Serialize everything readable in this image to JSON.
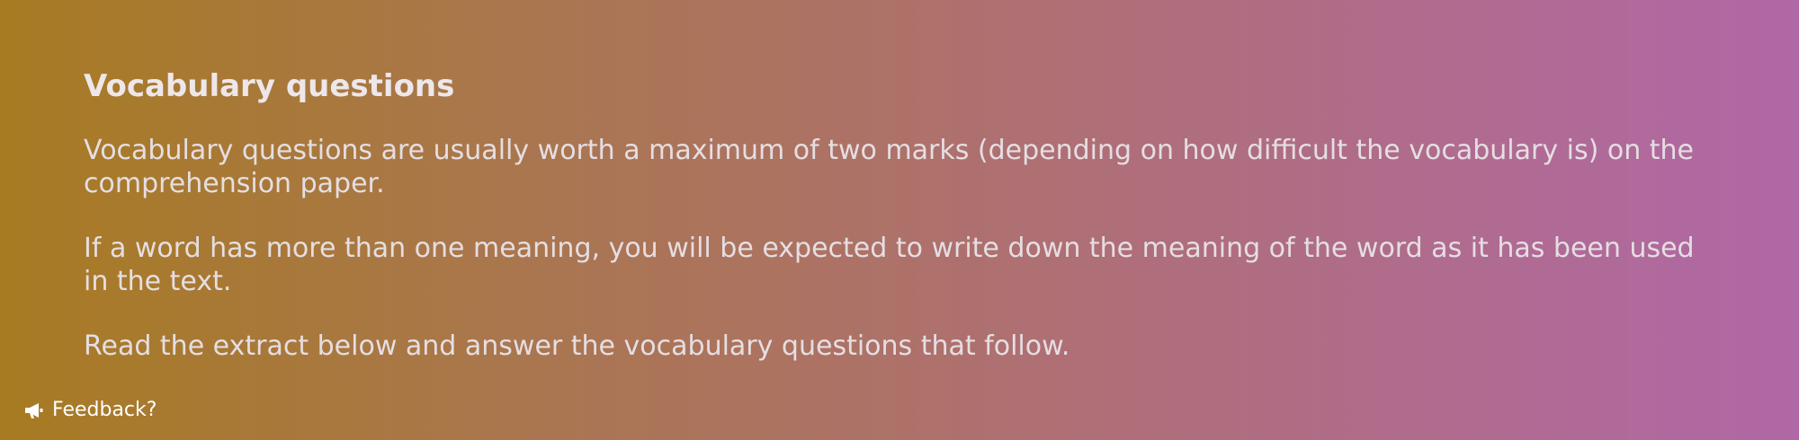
{
  "section": {
    "heading": "Vocabulary questions",
    "paragraphs": [
      "Vocabulary questions are usually worth a maximum of two marks (depending on how difficult the vocabulary is) on the comprehension paper.",
      "If a word has more than one meaning, you will be expected to write down the meaning of the word as it has been used in the text.",
      "Read the extract below and answer the vocabulary questions that follow."
    ]
  },
  "feedback": {
    "label": "Feedback?",
    "icon": "megaphone-icon"
  },
  "colors": {
    "gradient_start": "#A77B22",
    "gradient_end": "#B068A6",
    "text": "#E7E2E6"
  }
}
